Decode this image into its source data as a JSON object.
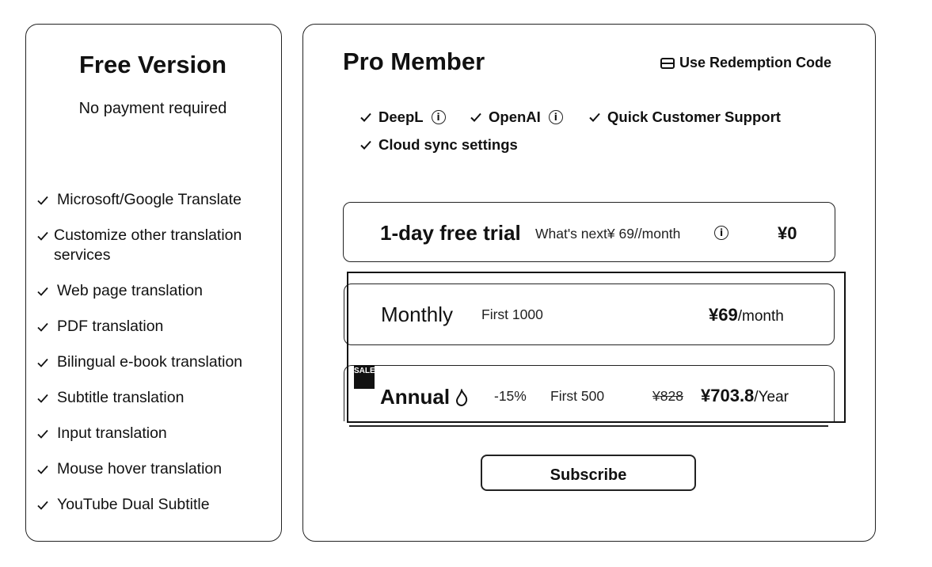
{
  "free": {
    "title": "Free Version",
    "subtitle": "No payment required",
    "features": [
      "Microsoft/Google Translate",
      "Customize other translation services",
      "Web page translation",
      "PDF translation",
      "Bilingual e-book translation",
      "Subtitle translation",
      "Input translation",
      "Mouse hover translation",
      "YouTube Dual Subtitle"
    ]
  },
  "pro": {
    "title": "Pro Member",
    "redeem_label": "Use Redemption Code",
    "features": [
      "DeepL",
      "OpenAI",
      "Quick Customer Support",
      "Cloud sync settings"
    ],
    "plans": [
      {
        "name": "1-day free trial",
        "note": "What's next¥ 69//month",
        "price": "¥0",
        "unit": ""
      },
      {
        "name": "Monthly",
        "note": "First 1000",
        "price": "¥69",
        "unit": "/month"
      },
      {
        "name": "Annual",
        "discount": "-15%",
        "note": "First 500",
        "old_price": "¥828",
        "price": "¥703.8",
        "unit": "/Year",
        "badge": "SALE"
      }
    ],
    "selected_plan": "Monthly",
    "subscribe_label": "Subscribe"
  },
  "colors": {
    "text": "#111111",
    "border": "#222222",
    "background": "#ffffff"
  },
  "icons": [
    "check-icon",
    "info-icon",
    "ticket-icon",
    "flame-icon"
  ]
}
